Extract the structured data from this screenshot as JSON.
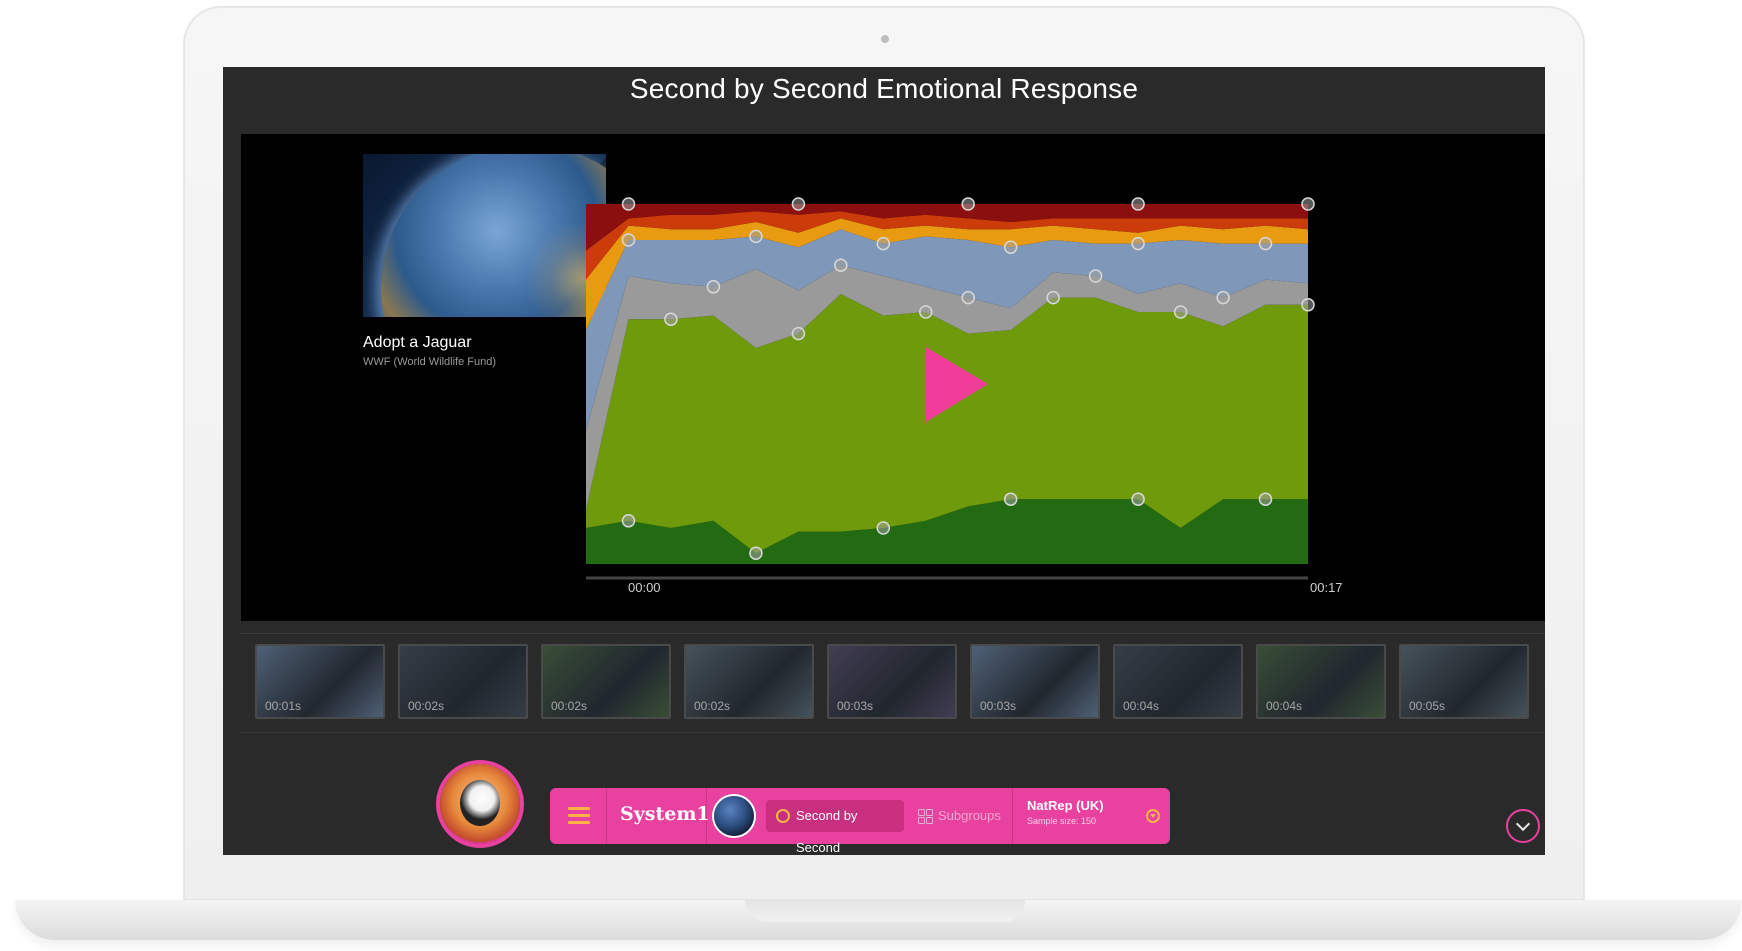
{
  "screen": {
    "title": "Second by Second Emotional Response"
  },
  "ad": {
    "title": "Adopt a Jaguar",
    "advertiser": "WWF (World Wildlife Fund)"
  },
  "timeline": {
    "start": "00:00",
    "end": "00:17"
  },
  "filmstrip": [
    {
      "label": "00:01s",
      "tint": "#5c7390"
    },
    {
      "label": "00:02s",
      "tint": "#3c4450"
    },
    {
      "label": "00:02s",
      "tint": "#3e5a3a"
    },
    {
      "label": "00:02s",
      "tint": "#50606a"
    },
    {
      "label": "00:03s",
      "tint": "#4a4460"
    },
    {
      "label": "00:03s",
      "tint": "#5c7390"
    },
    {
      "label": "00:04s",
      "tint": "#3c4450"
    },
    {
      "label": "00:04s",
      "tint": "#3e5a3a"
    },
    {
      "label": "00:05s",
      "tint": "#50606a"
    }
  ],
  "toolbar": {
    "brand": "System1",
    "active_tab": "Second by Second",
    "inactive_tab": "Subgroups",
    "sample_name": "NatRep (UK)",
    "sample_size": "Sample size: 150"
  },
  "colors": {
    "accent": "#e8419f",
    "play": "#f03d9a",
    "bands": [
      "#236b12",
      "#6e9a0c",
      "#9a9a9a",
      "#7f97b8",
      "#e89a10",
      "#cc3b0a",
      "#8c0f0f"
    ]
  },
  "icons": [
    "menu-icon",
    "smiley-icon",
    "grid-icon",
    "dropdown-icon",
    "chevron-down-icon",
    "play-icon"
  ],
  "chart_data": {
    "type": "area",
    "stacked": true,
    "x": [
      0,
      1,
      2,
      3,
      4,
      5,
      6,
      7,
      8,
      9,
      10,
      11,
      12,
      13,
      14,
      15,
      16,
      17
    ],
    "series": [
      {
        "name": "",
        "color": "#236b12",
        "values": [
          10,
          12,
          10,
          12,
          3,
          9,
          9,
          10,
          12,
          16,
          18,
          18,
          18,
          18,
          10,
          18,
          18,
          18
        ]
      },
      {
        "name": "",
        "color": "#6e9a0c",
        "values": [
          5,
          56,
          58,
          57,
          57,
          55,
          66,
          59,
          58,
          48,
          47,
          56,
          56,
          52,
          60,
          48,
          54,
          54
        ]
      },
      {
        "name": "",
        "color": "#9a9a9a",
        "values": [
          22,
          12,
          10,
          8,
          22,
          12,
          8,
          11,
          7,
          10,
          6,
          7,
          6,
          5,
          8,
          8,
          7,
          6
        ]
      },
      {
        "name": "",
        "color": "#7f97b8",
        "values": [
          28,
          10,
          12,
          13,
          9,
          12,
          10,
          9,
          14,
          16,
          17,
          9,
          9,
          14,
          12,
          15,
          10,
          11
        ]
      },
      {
        "name": "",
        "color": "#e89a10",
        "values": [
          14,
          4,
          3,
          3,
          4,
          4,
          3,
          4,
          3,
          3,
          5,
          4,
          4,
          3,
          4,
          4,
          5,
          4
        ]
      },
      {
        "name": "",
        "color": "#cc3b0a",
        "values": [
          8,
          2,
          4,
          4,
          3,
          5,
          2,
          3,
          3,
          3,
          2,
          2,
          3,
          4,
          2,
          3,
          2,
          3
        ]
      },
      {
        "name": "",
        "color": "#8c0f0f",
        "values": [
          13,
          4,
          3,
          3,
          2,
          3,
          2,
          4,
          3,
          4,
          5,
          4,
          4,
          4,
          4,
          4,
          4,
          4
        ]
      }
    ],
    "ylim": [
      0,
      100
    ],
    "xlabel": "",
    "ylabel": ""
  }
}
